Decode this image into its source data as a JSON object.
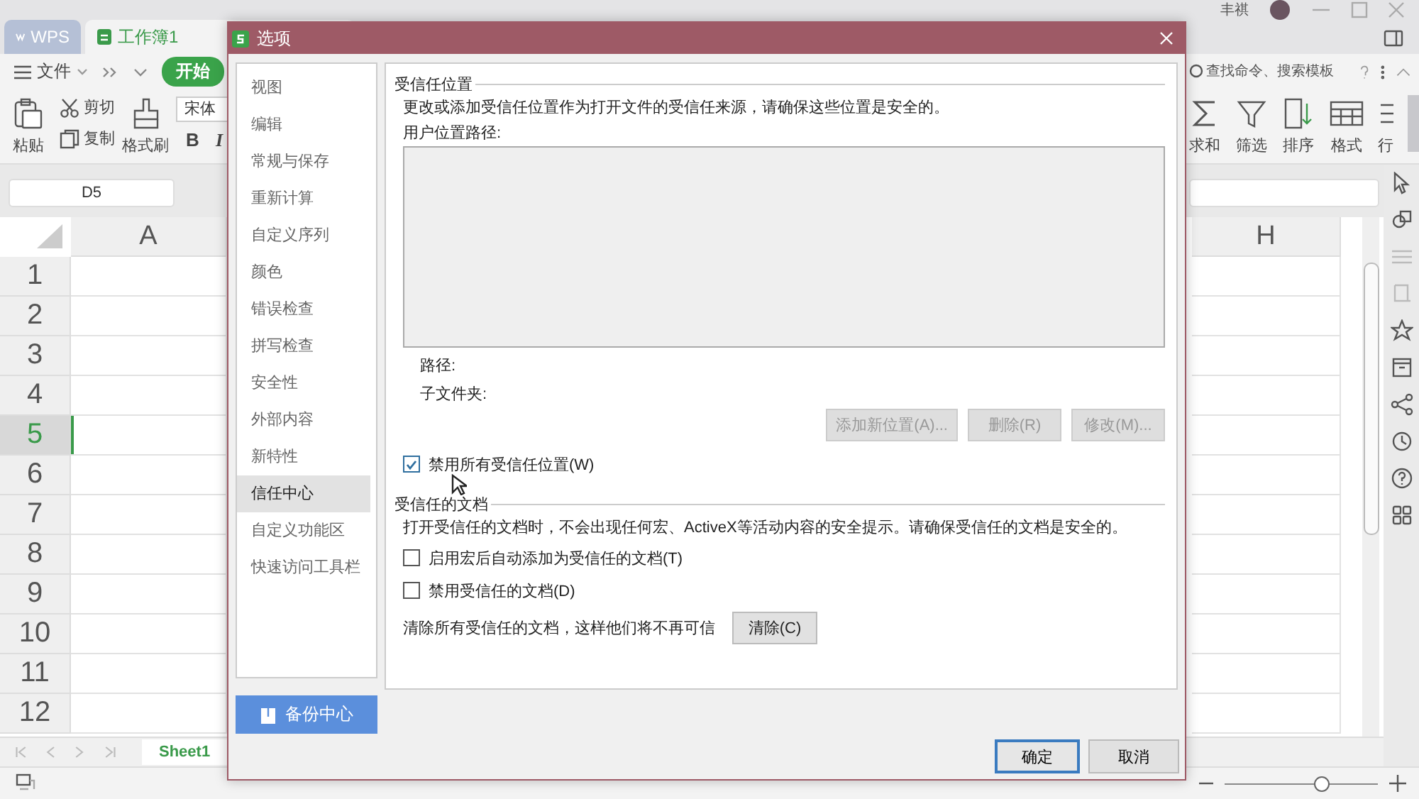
{
  "app_tabs": [
    {
      "label": "WPS",
      "kind": "home",
      "selected": false
    },
    {
      "label": "工作簿1",
      "kind": "sheet",
      "selected": true
    }
  ],
  "user": {
    "name": "丰祺"
  },
  "menu": {
    "file": "文件",
    "start_tab": "开始",
    "search_placeholder": "查找命令、搜索模板"
  },
  "ribbon": {
    "left": [
      {
        "label": "粘贴",
        "kind": "paste"
      },
      {
        "label": "剪切",
        "kind": "cut"
      },
      {
        "label": "复制",
        "kind": "copy"
      },
      {
        "label": "格式刷",
        "kind": "brush"
      }
    ],
    "font": "宋体",
    "bold": "B",
    "italic": "I",
    "right": [
      {
        "label": "求和",
        "kind": "sum"
      },
      {
        "label": "筛选",
        "kind": "filter"
      },
      {
        "label": "排序",
        "kind": "sort"
      },
      {
        "label": "格式",
        "kind": "format"
      },
      {
        "label": "行",
        "kind": "rows"
      }
    ]
  },
  "cell_ref": "D5",
  "sheet": {
    "columns": [
      "A",
      "H"
    ],
    "rows": [
      {
        "label": "1",
        "selected": false
      },
      {
        "label": "2",
        "selected": false
      },
      {
        "label": "3",
        "selected": false
      },
      {
        "label": "4",
        "selected": false
      },
      {
        "label": "5",
        "selected": true
      },
      {
        "label": "6",
        "selected": false
      },
      {
        "label": "7",
        "selected": false
      },
      {
        "label": "8",
        "selected": false
      },
      {
        "label": "9",
        "selected": false
      },
      {
        "label": "10",
        "selected": false
      },
      {
        "label": "11",
        "selected": false
      },
      {
        "label": "12",
        "selected": false
      }
    ]
  },
  "sheet_tabs": [
    {
      "label": "Sheet1",
      "selected": true
    }
  ],
  "status": {
    "zoom": {
      "level": 0.63
    }
  },
  "dialog": {
    "title": "选项",
    "nav": [
      {
        "label": "视图",
        "selected": false
      },
      {
        "label": "编辑",
        "selected": false
      },
      {
        "label": "常规与保存",
        "selected": false
      },
      {
        "label": "重新计算",
        "selected": false
      },
      {
        "label": "自定义序列",
        "selected": false
      },
      {
        "label": "颜色",
        "selected": false
      },
      {
        "label": "错误检查",
        "selected": false
      },
      {
        "label": "拼写检查",
        "selected": false
      },
      {
        "label": "安全性",
        "selected": false
      },
      {
        "label": "外部内容",
        "selected": false
      },
      {
        "label": "新特性",
        "selected": false
      },
      {
        "label": "信任中心",
        "selected": true
      },
      {
        "label": "自定义功能区",
        "selected": false
      },
      {
        "label": "快速访问工具栏",
        "selected": false
      }
    ],
    "backup_button": "备份中心",
    "locations": {
      "heading": "受信任位置",
      "description": "更改或添加受信任位置作为打开文件的受信任来源，请确保这些位置是安全的。",
      "list_label": "用户位置路径:",
      "path_label": "路径:",
      "subfolder_label": "子文件夹:",
      "buttons": [
        {
          "label": "添加新位置(A)...",
          "disabled": true
        },
        {
          "label": "删除(R)",
          "disabled": true
        },
        {
          "label": "修改(M)...",
          "disabled": true
        }
      ],
      "checkbox": {
        "label": "禁用所有受信任位置(W)",
        "checked": true
      }
    },
    "documents": {
      "heading": "受信任的文档",
      "description": "打开受信任的文档时，不会出现任何宏、ActiveX等活动内容的安全提示。请确保受信任的文档是安全的。",
      "checkboxes": [
        {
          "label": "启用宏后自动添加为受信任的文档(T)",
          "checked": false
        },
        {
          "label": "禁用受信任的文档(D)",
          "checked": false
        }
      ],
      "clear_text": "清除所有受信任的文档，这样他们将不再可信",
      "clear_button": {
        "label": "清除(C)",
        "disabled": false
      }
    },
    "ok": "确定",
    "cancel": "取消"
  }
}
